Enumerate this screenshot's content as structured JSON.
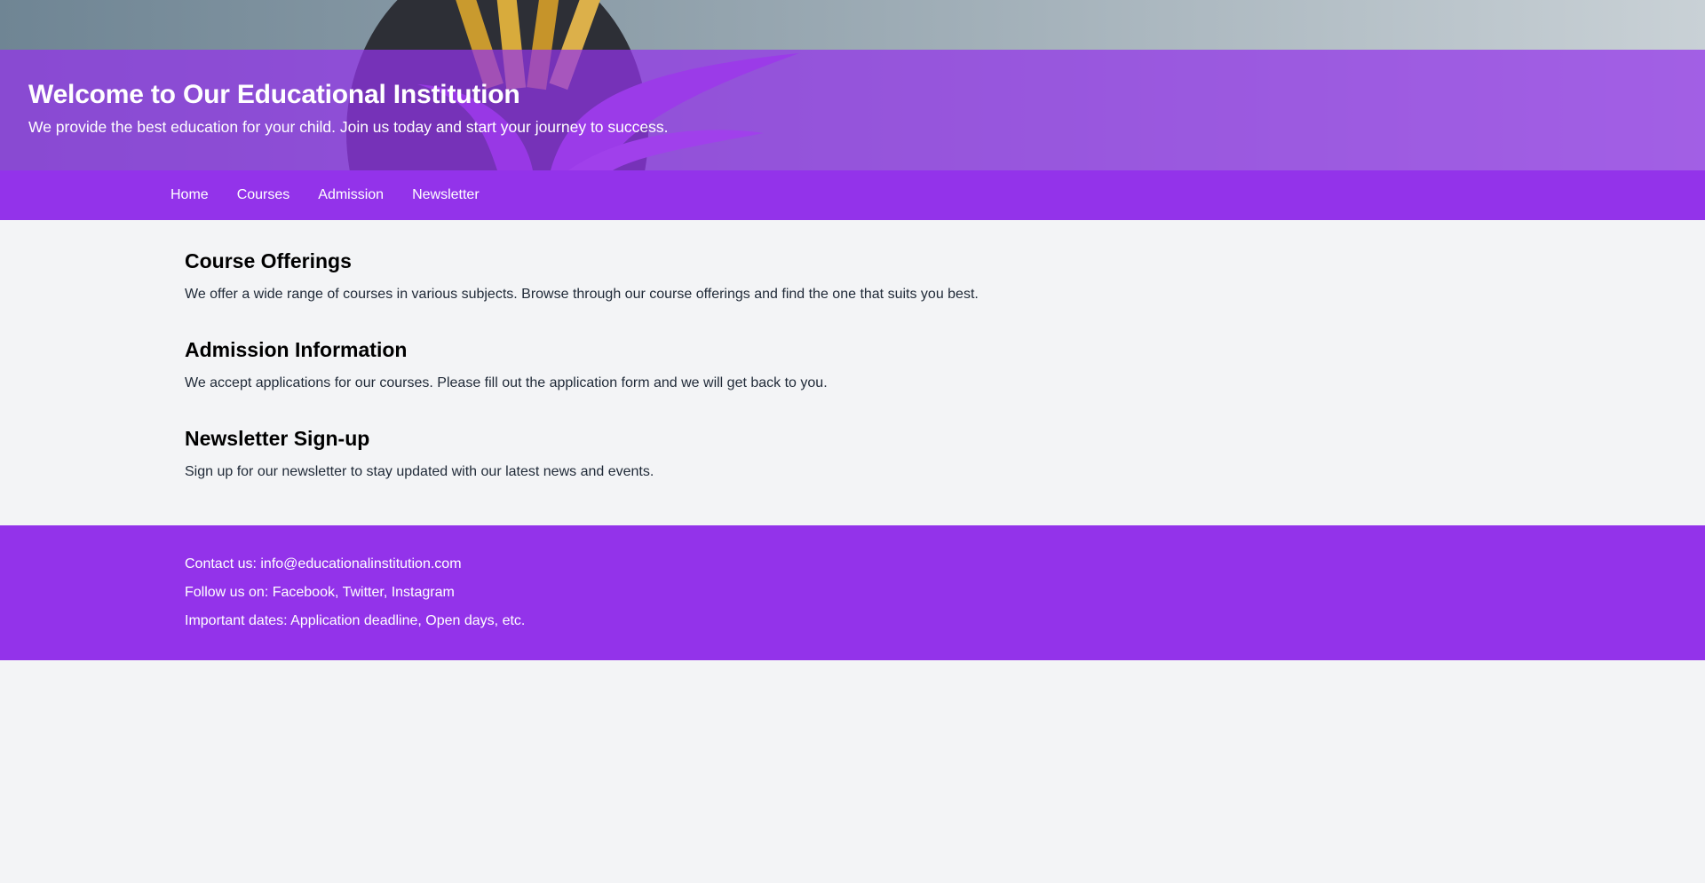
{
  "header": {
    "title": "Welcome to Our Educational Institution",
    "subtitle": "We provide the best education for your child. Join us today and start your journey to success."
  },
  "nav": {
    "items": [
      {
        "label": "Home"
      },
      {
        "label": "Courses"
      },
      {
        "label": "Admission"
      },
      {
        "label": "Newsletter"
      }
    ]
  },
  "main": {
    "sections": [
      {
        "title": "Course Offerings",
        "text": "We offer a wide range of courses in various subjects. Browse through our course offerings and find the one that suits you best."
      },
      {
        "title": "Admission Information",
        "text": "We accept applications for our courses. Please fill out the application form and we will get back to you."
      },
      {
        "title": "Newsletter Sign-up",
        "text": "Sign up for our newsletter to stay updated with our latest news and events."
      }
    ]
  },
  "footer": {
    "contact": "Contact us: info@educationalinstitution.com",
    "social": "Follow us on: Facebook, Twitter, Instagram",
    "dates": "Important dates: Application deadline, Open days, etc."
  },
  "colors": {
    "primary": "#9333ea",
    "background": "#f3f4f6",
    "text": "#1f2937"
  }
}
